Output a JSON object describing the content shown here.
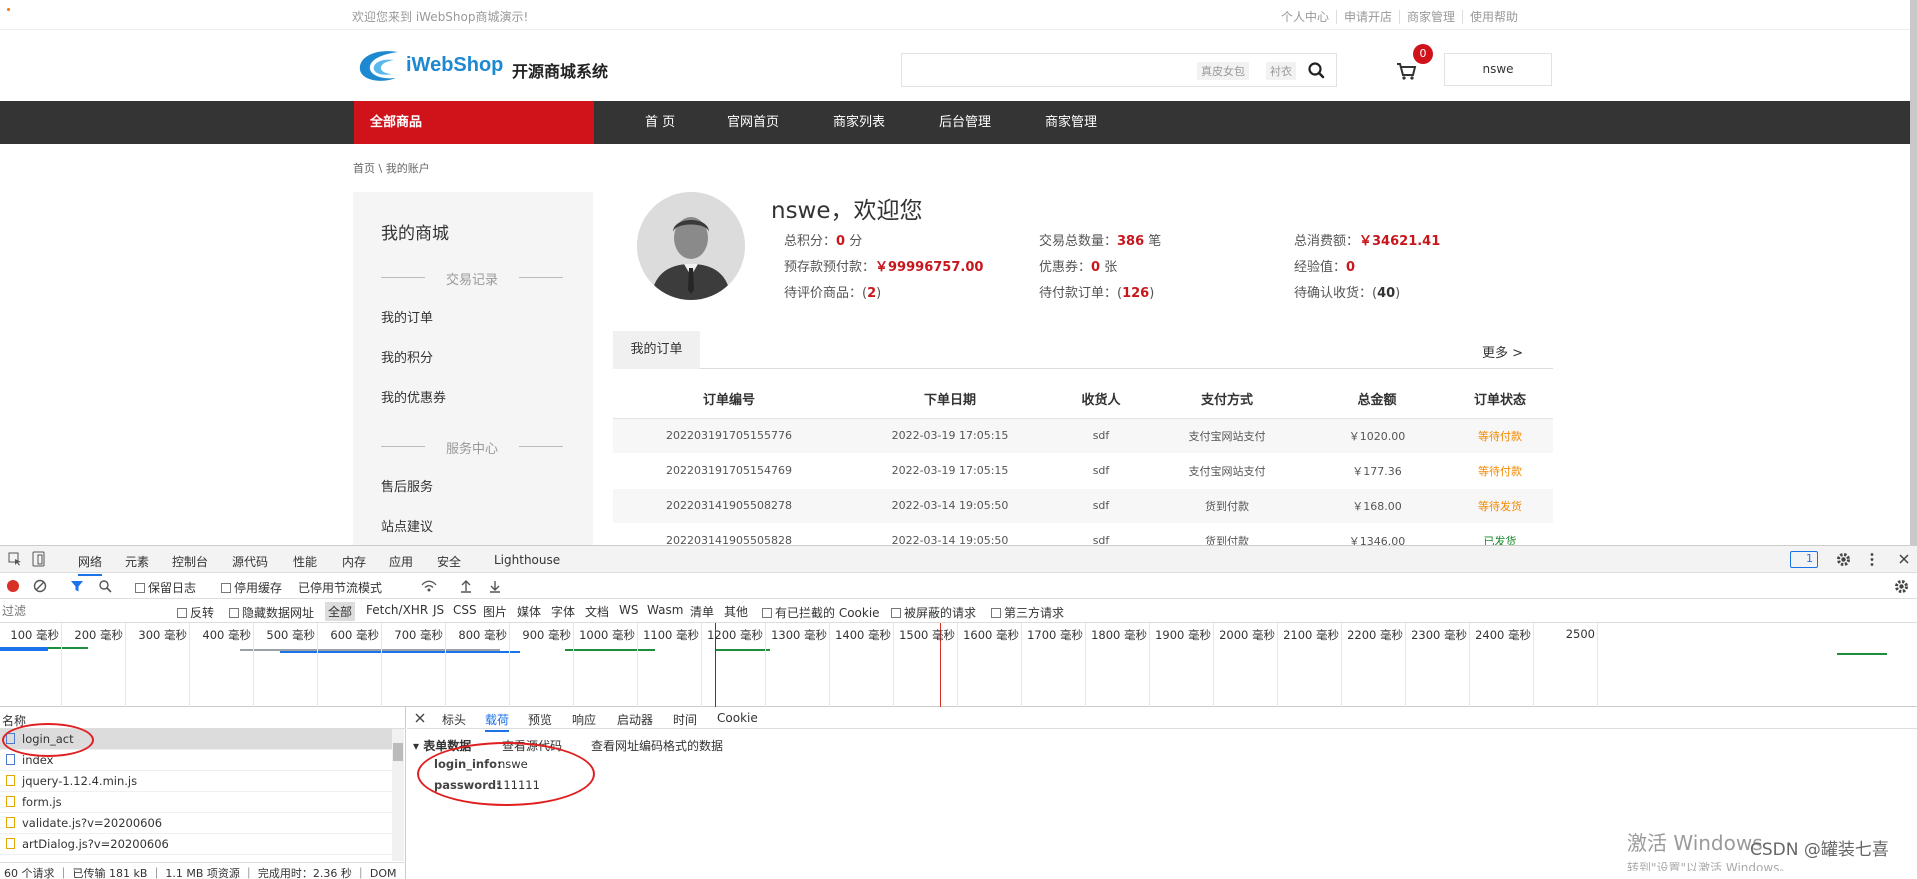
{
  "topbar": {
    "welcome": "欢迎您来到 iWebShop商城演示!",
    "links": [
      "个人中心",
      "申请开店",
      "商家管理",
      "使用帮助"
    ]
  },
  "header": {
    "brand": "iWebShop",
    "brand_sub": "开源商城系统",
    "search_tags": [
      "真皮女包",
      "衬衣"
    ],
    "cart_count": "0",
    "username": "nswe"
  },
  "nav": {
    "all_label": "全部商品",
    "items": [
      "首 页",
      "官网首页",
      "商家列表",
      "后台管理",
      "商家管理"
    ]
  },
  "breadcrumb": "首页 \\ 我的账户",
  "sidebar": {
    "title": "我的商城",
    "section1": "交易记录",
    "links1": [
      "我的订单",
      "我的积分",
      "我的优惠券"
    ],
    "section2": "服务中心",
    "links2": [
      "售后服务",
      "站点建议"
    ]
  },
  "profile": {
    "greeting": "nswe，欢迎您",
    "points_label": "总积分：",
    "points": "0",
    "points_unit": " 分",
    "trades_label": "交易总数量：",
    "trades": "386",
    "trades_unit": " 笔",
    "spend_label": "总消费额：",
    "spend": "￥34621.41",
    "deposit_label": "预存款预付款：",
    "deposit": "￥99996757.00",
    "coupons_label": "优惠券：",
    "coupons": "0",
    "coupons_unit": " 张",
    "exp_label": "经验值：",
    "exp": "0",
    "to_review_label": "待评价商品：(",
    "to_review": "2",
    "to_review_end": ")",
    "to_pay_label": "待付款订单：(",
    "to_pay": "126",
    "to_pay_end": ")",
    "to_receive_label": "待确认收货：(",
    "to_receive": "40",
    "to_receive_end": ")"
  },
  "orders": {
    "tab": "我的订单",
    "more": "更多 >",
    "headers": [
      "订单编号",
      "下单日期",
      "收货人",
      "支付方式",
      "总金额",
      "订单状态"
    ],
    "rows": [
      [
        "202203191705155776",
        "2022-03-19 17:05:15",
        "sdf",
        "支付宝网站支付",
        "￥1020.00",
        "等待付款"
      ],
      [
        "202203191705154769",
        "2022-03-19 17:05:15",
        "sdf",
        "支付宝网站支付",
        "￥177.36",
        "等待付款"
      ],
      [
        "202203141905508278",
        "2022-03-14 19:05:50",
        "sdf",
        "货到付款",
        "￥168.00",
        "等待发货"
      ],
      [
        "202203141905505828",
        "2022-03-14 19:05:50",
        "sdf",
        "货到付款",
        "￥1346.00",
        "已发货"
      ]
    ]
  },
  "devtools": {
    "tabs": [
      "网络",
      "元素",
      "控制台",
      "源代码",
      "性能",
      "内存",
      "应用",
      "安全",
      "Lighthouse"
    ],
    "issues_count": "1",
    "toolbar": {
      "preserve_log": "保留日志",
      "disable_cache": "停用缓存",
      "throttle": "已停用节流模式"
    },
    "filter": {
      "placeholder": "过滤",
      "invert": "反转",
      "hide_data": "隐藏数据网址",
      "types": [
        "全部",
        "Fetch/XHR",
        "JS",
        "CSS",
        "图片",
        "媒体",
        "字体",
        "文档",
        "WS",
        "Wasm",
        "清单",
        "其他"
      ],
      "blocked_cookies": "有已拦截的 Cookie",
      "blocked_requests": "被屏蔽的请求",
      "third_party": "第三方请求"
    },
    "timeline_ticks": [
      "100 毫秒",
      "200 毫秒",
      "300 毫秒",
      "400 毫秒",
      "500 毫秒",
      "600 毫秒",
      "700 毫秒",
      "800 毫秒",
      "900 毫秒",
      "1000 毫秒",
      "1100 毫秒",
      "1200 毫秒",
      "1300 毫秒",
      "1400 毫秒",
      "1500 毫秒",
      "1600 毫秒",
      "1700 毫秒",
      "1800 毫秒",
      "1900 毫秒",
      "2000 毫秒",
      "2100 毫秒",
      "2200 毫秒",
      "2300 毫秒",
      "2400 毫秒",
      "2500"
    ],
    "names_header": "名称",
    "requests": [
      "login_act",
      "index",
      "jquery-1.12.4.min.js",
      "form.js",
      "validate.js?v=20200606",
      "artDialog.js?v=20200606"
    ],
    "status_bar": "60 个请求 ｜ 已传输 181 kB ｜ 1.1 MB 项资源 ｜ 完成用时：2.36 秒 ｜ DOM",
    "detail_tabs": [
      "标头",
      "载荷",
      "预览",
      "响应",
      "启动器",
      "时间",
      "Cookie"
    ],
    "form_section": "▾ 表单数据",
    "view_source": "查看源代码",
    "view_url_encoded": "查看网址编码格式的数据",
    "form_fields": [
      {
        "key": "login_info:",
        "value": "nswe"
      },
      {
        "key": "password:",
        "value": "111111"
      }
    ]
  },
  "watermark": {
    "activate": "激活 Windows",
    "csdn": "CSDN @罐装七喜",
    "activate_sub": "转到\"设置\"以激活 Windows。"
  },
  "colors": {
    "brand_red": "#d0121b",
    "nav_dark": "#343434",
    "logo_blue": "#1e88d0",
    "status_orange": "#f28a00",
    "status_green": "#1a8b2c",
    "annotation_red": "#e02020"
  }
}
